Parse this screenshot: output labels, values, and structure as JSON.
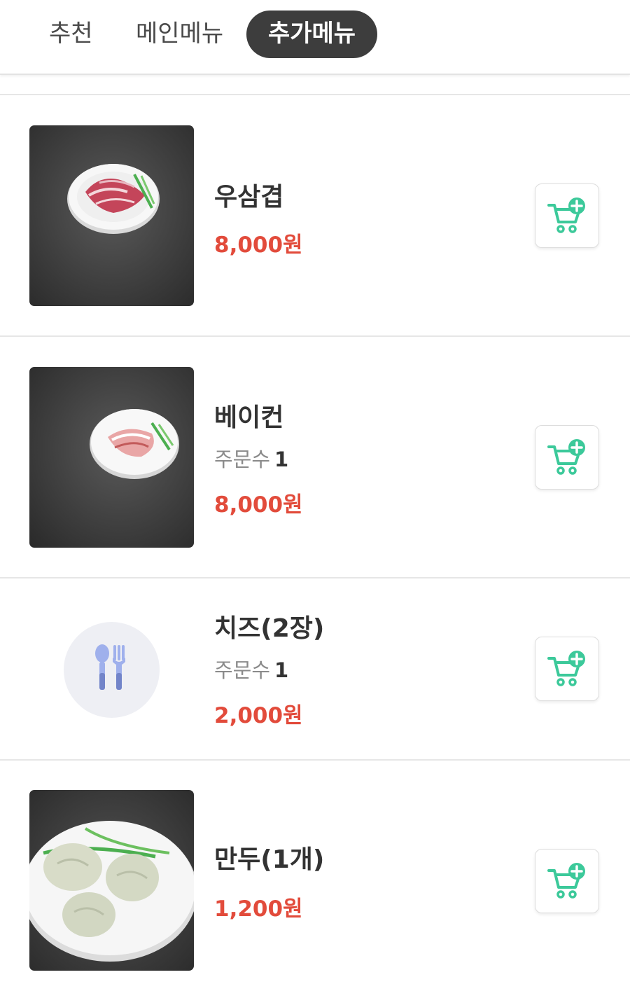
{
  "tabs": [
    {
      "label": "추천",
      "active": false
    },
    {
      "label": "메인메뉴",
      "active": false
    },
    {
      "label": "추가메뉴",
      "active": true
    }
  ],
  "colors": {
    "active_tab_bg": "#3d3d3d",
    "price": "#e24b3b",
    "cart_accent": "#3cc99a",
    "placeholder_bg": "#eeeff4",
    "placeholder_icon": "#7b8fd6"
  },
  "items": [
    {
      "name": "우삼겹",
      "price": "8,000원",
      "image": "beef-brisket-photo",
      "cart_icon": "cart-add-icon"
    },
    {
      "name": "베이컨",
      "order_label": "주문수",
      "order_count": "1",
      "price": "8,000원",
      "image": "bacon-photo",
      "cart_icon": "cart-add-icon"
    },
    {
      "name": "치즈(2장)",
      "order_label": "주문수",
      "order_count": "1",
      "price": "2,000원",
      "image": "utensils-placeholder-icon",
      "cart_icon": "cart-add-icon"
    },
    {
      "name": "만두(1개)",
      "price": "1,200원",
      "image": "dumpling-photo",
      "cart_icon": "cart-add-icon"
    }
  ]
}
